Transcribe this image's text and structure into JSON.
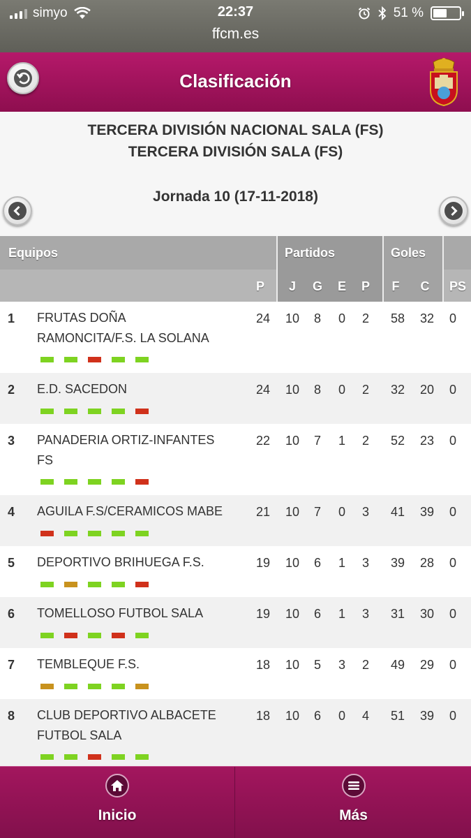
{
  "status_bar": {
    "carrier": "simyo",
    "time": "22:37",
    "url": "ffcm.es",
    "battery": "51 %"
  },
  "header": {
    "title": "Clasificación"
  },
  "competition": {
    "line1": "TERCERA DIVISIÓN NACIONAL SALA (FS)",
    "line2": "TERCERA DIVISIÓN SALA (FS)",
    "jornada": "Jornada 10 (17-11-2018)"
  },
  "table": {
    "group_headers": {
      "equipos": "Equipos",
      "partidos": "Partidos",
      "goles": "Goles"
    },
    "columns": {
      "p": "P",
      "j": "J",
      "g": "G",
      "e": "E",
      "pp": "P",
      "f": "F",
      "c": "C",
      "ps": "PS"
    },
    "rows": [
      {
        "pos": "1",
        "team_line1": "FRUTAS DOÑA",
        "team_line2": "RAMONCITA/F.S. LA SOLANA",
        "p": "24",
        "j": "10",
        "g": "8",
        "e": "0",
        "pp": "2",
        "f": "58",
        "c": "32",
        "ps": "0",
        "form": [
          "W",
          "W",
          "L",
          "W",
          "W"
        ]
      },
      {
        "pos": "2",
        "team_line1": "E.D. SACEDON",
        "team_line2": "",
        "p": "24",
        "j": "10",
        "g": "8",
        "e": "0",
        "pp": "2",
        "f": "32",
        "c": "20",
        "ps": "0",
        "form": [
          "W",
          "W",
          "W",
          "W",
          "L"
        ]
      },
      {
        "pos": "3",
        "team_line1": "PANADERIA ORTIZ-INFANTES",
        "team_line2": "FS",
        "p": "22",
        "j": "10",
        "g": "7",
        "e": "1",
        "pp": "2",
        "f": "52",
        "c": "23",
        "ps": "0",
        "form": [
          "W",
          "W",
          "W",
          "W",
          "L"
        ]
      },
      {
        "pos": "4",
        "team_line1": "AGUILA F.S/CERAMICOS MABE",
        "team_line2": "",
        "p": "21",
        "j": "10",
        "g": "7",
        "e": "0",
        "pp": "3",
        "f": "41",
        "c": "39",
        "ps": "0",
        "form": [
          "L",
          "W",
          "W",
          "W",
          "W"
        ]
      },
      {
        "pos": "5",
        "team_line1": "DEPORTIVO BRIHUEGA F.S.",
        "team_line2": "",
        "p": "19",
        "j": "10",
        "g": "6",
        "e": "1",
        "pp": "3",
        "f": "39",
        "c": "28",
        "ps": "0",
        "form": [
          "W",
          "D",
          "W",
          "W",
          "L"
        ]
      },
      {
        "pos": "6",
        "team_line1": "TOMELLOSO FUTBOL SALA",
        "team_line2": "",
        "p": "19",
        "j": "10",
        "g": "6",
        "e": "1",
        "pp": "3",
        "f": "31",
        "c": "30",
        "ps": "0",
        "form": [
          "W",
          "L",
          "W",
          "L",
          "W"
        ]
      },
      {
        "pos": "7",
        "team_line1": "TEMBLEQUE F.S.",
        "team_line2": "",
        "p": "18",
        "j": "10",
        "g": "5",
        "e": "3",
        "pp": "2",
        "f": "49",
        "c": "29",
        "ps": "0",
        "form": [
          "D",
          "W",
          "W",
          "W",
          "D"
        ]
      },
      {
        "pos": "8",
        "team_line1": "CLUB DEPORTIVO ALBACETE",
        "team_line2": "FUTBOL SALA",
        "p": "18",
        "j": "10",
        "g": "6",
        "e": "0",
        "pp": "4",
        "f": "51",
        "c": "39",
        "ps": "0",
        "form": [
          "W",
          "W",
          "L",
          "W",
          "W"
        ]
      }
    ]
  },
  "colors": {
    "win": "#7ed321",
    "loss": "#d0311b",
    "draw": "#c8921e",
    "header_magenta": "#a3165e"
  },
  "bottom_nav": {
    "home_label": "Inicio",
    "home_icon": "home-icon",
    "more_label": "Más",
    "more_icon": "menu-icon"
  }
}
